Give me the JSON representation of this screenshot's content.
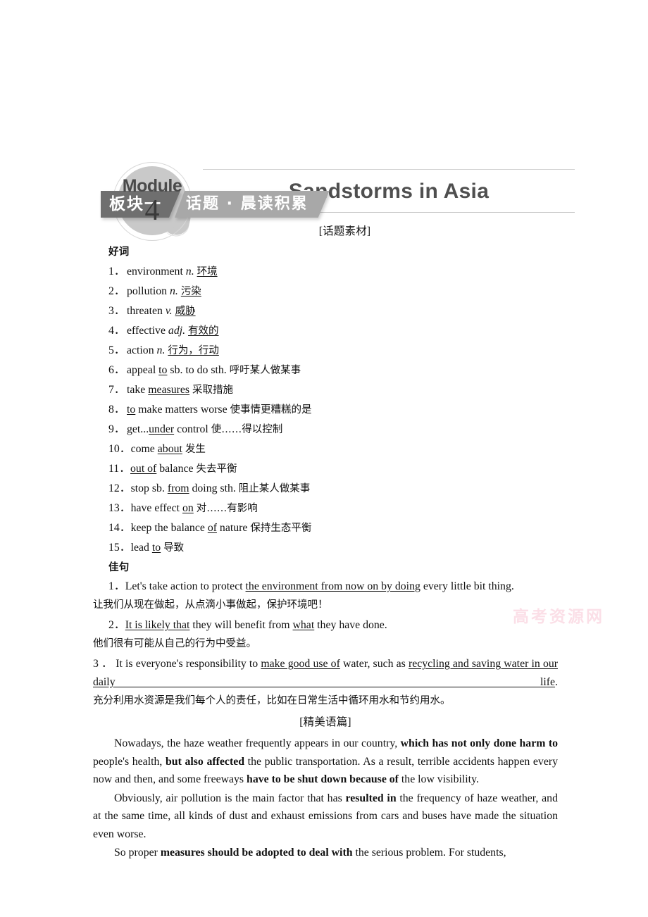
{
  "header": {
    "module_label": "Module",
    "module_number": "4",
    "title": "Sandstorms in Asia"
  },
  "banner": {
    "left_label": "板块一",
    "right_label": "话题 · 晨读积累"
  },
  "sections": {
    "material_tag": "[话题素材]",
    "words_heading": "好词",
    "sentences_heading": "佳句",
    "essay_tag": "[精美语篇]"
  },
  "words": [
    {
      "num": "1．",
      "parts": [
        {
          "t": "environment ",
          "s": "plain"
        },
        {
          "t": "n.",
          "s": "italic"
        },
        {
          "t": " ",
          "s": "plain"
        },
        {
          "t": "环境",
          "s": "cn-underline"
        }
      ]
    },
    {
      "num": "2．",
      "parts": [
        {
          "t": "pollution ",
          "s": "plain"
        },
        {
          "t": "n.",
          "s": "italic"
        },
        {
          "t": " ",
          "s": "plain"
        },
        {
          "t": "污染",
          "s": "cn-underline"
        }
      ]
    },
    {
      "num": "3．",
      "parts": [
        {
          "t": "threaten ",
          "s": "plain"
        },
        {
          "t": "v.",
          "s": "italic"
        },
        {
          "t": " ",
          "s": "plain"
        },
        {
          "t": "威胁",
          "s": "cn-underline"
        }
      ]
    },
    {
      "num": "4．",
      "parts": [
        {
          "t": "effective ",
          "s": "plain"
        },
        {
          "t": "adj.",
          "s": "italic"
        },
        {
          "t": " ",
          "s": "plain"
        },
        {
          "t": "有效的",
          "s": "cn-underline"
        }
      ]
    },
    {
      "num": "5．",
      "parts": [
        {
          "t": "action ",
          "s": "plain"
        },
        {
          "t": "n.",
          "s": "italic"
        },
        {
          "t": " ",
          "s": "plain"
        },
        {
          "t": "行为，行动",
          "s": "cn-underline"
        }
      ]
    },
    {
      "num": "6．",
      "parts": [
        {
          "t": "appeal ",
          "s": "plain"
        },
        {
          "t": "to",
          "s": "underline"
        },
        {
          "t": " sb. to do sth.  ",
          "s": "plain"
        },
        {
          "t": "呼吁某人做某事",
          "s": "cn"
        }
      ]
    },
    {
      "num": "7．",
      "parts": [
        {
          "t": "take ",
          "s": "plain"
        },
        {
          "t": "measures",
          "s": "underline"
        },
        {
          "t": "  ",
          "s": "plain"
        },
        {
          "t": "采取措施",
          "s": "cn"
        }
      ]
    },
    {
      "num": "8．",
      "parts": [
        {
          "t": "to",
          "s": "underline"
        },
        {
          "t": " make matters worse  ",
          "s": "plain"
        },
        {
          "t": "使事情更糟糕的是",
          "s": "cn"
        }
      ]
    },
    {
      "num": "9．",
      "parts": [
        {
          "t": "get...",
          "s": "plain"
        },
        {
          "t": "under",
          "s": "underline"
        },
        {
          "t": " control  ",
          "s": "plain"
        },
        {
          "t": "使……得以控制",
          "s": "cn"
        }
      ]
    },
    {
      "num": "10．",
      "parts": [
        {
          "t": "come ",
          "s": "plain"
        },
        {
          "t": "about",
          "s": "underline"
        },
        {
          "t": "  ",
          "s": "plain"
        },
        {
          "t": "发生",
          "s": "cn"
        }
      ]
    },
    {
      "num": "11．",
      "parts": [
        {
          "t": "out of",
          "s": "underline"
        },
        {
          "t": " balance  ",
          "s": "plain"
        },
        {
          "t": "失去平衡",
          "s": "cn"
        }
      ]
    },
    {
      "num": "12．",
      "parts": [
        {
          "t": "stop sb. ",
          "s": "plain"
        },
        {
          "t": "from",
          "s": "underline"
        },
        {
          "t": " doing sth.  ",
          "s": "plain"
        },
        {
          "t": "阻止某人做某事",
          "s": "cn"
        }
      ]
    },
    {
      "num": "13．",
      "parts": [
        {
          "t": "have effect ",
          "s": "plain"
        },
        {
          "t": "on",
          "s": "underline"
        },
        {
          "t": "  ",
          "s": "plain"
        },
        {
          "t": "对……有影响",
          "s": "cn"
        }
      ]
    },
    {
      "num": "14．",
      "parts": [
        {
          "t": "keep the balance ",
          "s": "plain"
        },
        {
          "t": "of",
          "s": "underline"
        },
        {
          "t": " nature  ",
          "s": "plain"
        },
        {
          "t": "保持生态平衡",
          "s": "cn"
        }
      ]
    },
    {
      "num": "15．",
      "parts": [
        {
          "t": "lead ",
          "s": "plain"
        },
        {
          "t": "to",
          "s": "underline"
        },
        {
          "t": "  ",
          "s": "plain"
        },
        {
          "t": "导致",
          "s": "cn"
        }
      ]
    }
  ],
  "sentences": [
    {
      "num": "1．",
      "justify": false,
      "en_parts": [
        {
          "t": "Let's take action to protect ",
          "s": "plain"
        },
        {
          "t": "the environment from now on  by doing",
          "s": "underline"
        },
        {
          "t": " every little bit thing.",
          "s": "plain"
        }
      ],
      "cn": "让我们从现在做起，从点滴小事做起，保护环境吧！"
    },
    {
      "num": "2．",
      "justify": false,
      "en_parts": [
        {
          "t": "It is likely that",
          "s": "underline"
        },
        {
          "t": " they will benefit from ",
          "s": "plain"
        },
        {
          "t": "what",
          "s": "underline"
        },
        {
          "t": " they have done.",
          "s": "plain"
        }
      ],
      "cn": "他们很有可能从自己的行为中受益。"
    },
    {
      "num": "3．",
      "justify": true,
      "en_parts": [
        {
          "t": "It is everyone's responsibility to ",
          "s": "plain"
        },
        {
          "t": "make good use of",
          "s": "underline"
        },
        {
          "t": " water, such as ",
          "s": "plain"
        },
        {
          "t": "recycling and saving water in our daily life",
          "s": "underline"
        },
        {
          "t": ".",
          "s": "plain"
        }
      ],
      "cn": "充分利用水资源是我们每个人的责任，比如在日常生活中循环用水和节约用水。"
    }
  ],
  "essay": [
    [
      {
        "t": "Nowadays, the haze weather frequently appears in our country, ",
        "s": "plain"
      },
      {
        "t": "which has not only done harm to",
        "s": "bold"
      },
      {
        "t": " people's health, ",
        "s": "plain"
      },
      {
        "t": "but also affected",
        "s": "bold"
      },
      {
        "t": " the public transportation. As a result, terrible accidents happen every now and then, and some freeways ",
        "s": "plain"
      },
      {
        "t": "have to be shut down because of",
        "s": "bold"
      },
      {
        "t": " the low visibility.",
        "s": "plain"
      }
    ],
    [
      {
        "t": "Obviously, air pollution is the main factor that has ",
        "s": "plain"
      },
      {
        "t": "resulted in",
        "s": "bold"
      },
      {
        "t": " the frequency of haze weather, and at the same time, all kinds of dust and exhaust emissions from cars and buses have made the situation even worse.",
        "s": "plain"
      }
    ],
    [
      {
        "t": "So proper ",
        "s": "plain"
      },
      {
        "t": "measures should be adopted to deal with",
        "s": "bold"
      },
      {
        "t": " the serious problem. For students,",
        "s": "plain"
      }
    ]
  ],
  "watermark": {
    "text": "高考资源网",
    "color": "#f7b9cb"
  }
}
